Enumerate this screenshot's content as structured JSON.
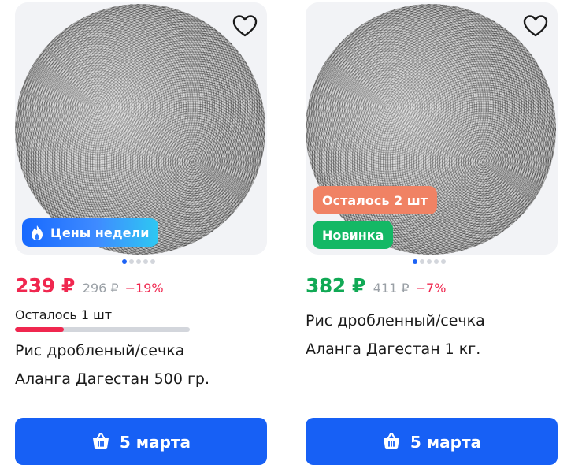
{
  "cards": [
    {
      "badges": {
        "week_label": "Цены недели"
      },
      "price": "239 ₽",
      "old_price": "296 ₽",
      "discount": "−19%",
      "stock_text": "Осталось 1 шт",
      "stock_level": 0.28,
      "title_line1": "Рис дробленый/сечка",
      "title_line2": "Аланга Дагестан 500 гр.",
      "cta_label": "5 марта"
    },
    {
      "badges": {
        "left_label": "Осталось 2 шт",
        "new_label": "Новинка"
      },
      "price": "382 ₽",
      "old_price": "411 ₽",
      "discount": "−7%",
      "title_line1": "Рис дробленный/сечка",
      "title_line2": "Аланга Дагестан 1 кг.",
      "cta_label": "5 марта"
    }
  ],
  "colors": {
    "accent": "#1760f5",
    "sale_red": "#f0274f",
    "price_green": "#11a955",
    "badge_new": "#14b865",
    "badge_left": "#f08264"
  },
  "icons": [
    "heart-icon",
    "fire-icon",
    "basket-icon"
  ]
}
